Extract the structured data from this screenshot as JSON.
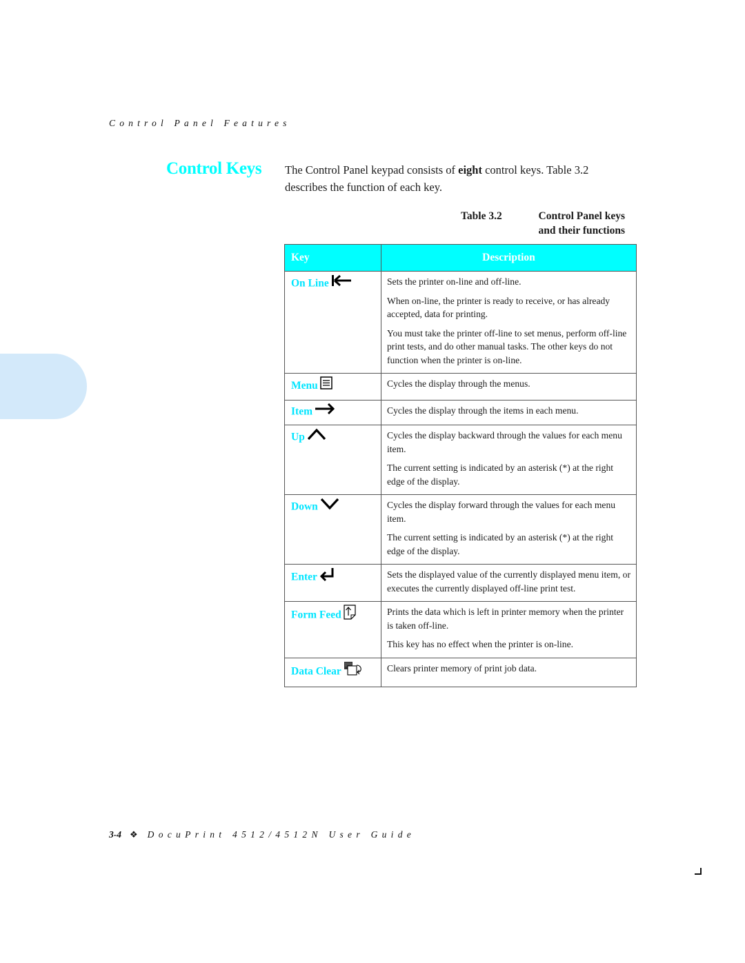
{
  "running_head": "Control Panel Features",
  "section": {
    "title": "Control Keys",
    "intro_before_bold": "The Control Panel keypad consists of ",
    "intro_bold": "eight",
    "intro_after_bold": " control keys. Table 3.2 describes the function of each key."
  },
  "table": {
    "caption_number": "Table 3.2",
    "caption_title_line1": "Control Panel keys",
    "caption_title_line2": "and their functions",
    "headers": {
      "key": "Key",
      "description": "Description"
    },
    "header_color": "#00ffff",
    "key_label_color": "#00e5ff",
    "rows": [
      {
        "key": "On Line",
        "icon": "arrow-left-bar-icon",
        "description": [
          "Sets the printer on-line and off-line.",
          "When on-line, the printer is ready to receive, or has already accepted, data for printing.",
          "You must take the printer off-line to set menus, perform off-line print tests, and do other manual tasks. The other keys do not function when the printer is on-line."
        ]
      },
      {
        "key": "Menu",
        "icon": "menu-lines-icon",
        "description": [
          "Cycles the display through the menus."
        ]
      },
      {
        "key": "Item",
        "icon": "arrow-right-icon",
        "description": [
          "Cycles the display through the items in each menu."
        ]
      },
      {
        "key": "Up",
        "icon": "chevron-up-icon",
        "description": [
          "Cycles the display backward through the values for each menu item.",
          "The current setting is indicated by an asterisk (*) at the right edge of the display."
        ]
      },
      {
        "key": "Down",
        "icon": "chevron-down-icon",
        "description": [
          "Cycles the display forward through the values for each menu item.",
          "The current setting is indicated by an asterisk (*) at the right edge of the display."
        ]
      },
      {
        "key": "Enter",
        "icon": "enter-return-icon",
        "description": [
          "Sets the displayed value of the currently displayed menu item, or executes the currently displayed off-line print test."
        ]
      },
      {
        "key": "Form Feed",
        "icon": "form-feed-page-icon",
        "description": [
          "Prints the data which is left in printer memory when the printer is taken off-line.",
          "This key has no effect when the printer is on-line."
        ]
      },
      {
        "key": "Data Clear",
        "icon": "data-clear-icon",
        "description": [
          "Clears printer memory of print job data."
        ]
      }
    ]
  },
  "footer": {
    "page_number": "3-4",
    "separator": "❖",
    "guide_title": "DocuPrint 4512/4512N User Guide"
  },
  "side_tab_color": "#d3e9fa"
}
